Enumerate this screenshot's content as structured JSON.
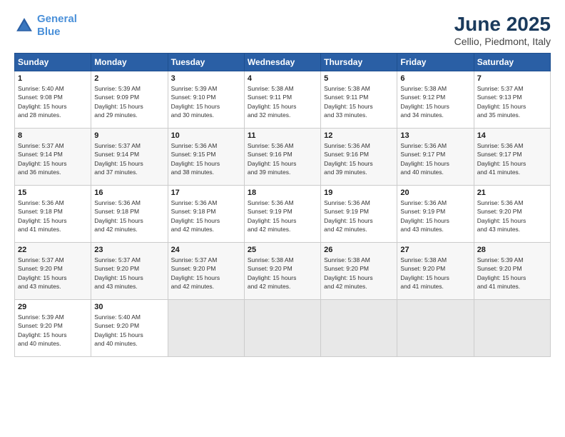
{
  "logo": {
    "line1": "General",
    "line2": "Blue"
  },
  "title": "June 2025",
  "subtitle": "Cellio, Piedmont, Italy",
  "weekdays": [
    "Sunday",
    "Monday",
    "Tuesday",
    "Wednesday",
    "Thursday",
    "Friday",
    "Saturday"
  ],
  "weeks": [
    [
      {
        "day": "1",
        "info": "Sunrise: 5:40 AM\nSunset: 9:08 PM\nDaylight: 15 hours\nand 28 minutes."
      },
      {
        "day": "2",
        "info": "Sunrise: 5:39 AM\nSunset: 9:09 PM\nDaylight: 15 hours\nand 29 minutes."
      },
      {
        "day": "3",
        "info": "Sunrise: 5:39 AM\nSunset: 9:10 PM\nDaylight: 15 hours\nand 30 minutes."
      },
      {
        "day": "4",
        "info": "Sunrise: 5:38 AM\nSunset: 9:11 PM\nDaylight: 15 hours\nand 32 minutes."
      },
      {
        "day": "5",
        "info": "Sunrise: 5:38 AM\nSunset: 9:11 PM\nDaylight: 15 hours\nand 33 minutes."
      },
      {
        "day": "6",
        "info": "Sunrise: 5:38 AM\nSunset: 9:12 PM\nDaylight: 15 hours\nand 34 minutes."
      },
      {
        "day": "7",
        "info": "Sunrise: 5:37 AM\nSunset: 9:13 PM\nDaylight: 15 hours\nand 35 minutes."
      }
    ],
    [
      {
        "day": "8",
        "info": "Sunrise: 5:37 AM\nSunset: 9:14 PM\nDaylight: 15 hours\nand 36 minutes."
      },
      {
        "day": "9",
        "info": "Sunrise: 5:37 AM\nSunset: 9:14 PM\nDaylight: 15 hours\nand 37 minutes."
      },
      {
        "day": "10",
        "info": "Sunrise: 5:36 AM\nSunset: 9:15 PM\nDaylight: 15 hours\nand 38 minutes."
      },
      {
        "day": "11",
        "info": "Sunrise: 5:36 AM\nSunset: 9:16 PM\nDaylight: 15 hours\nand 39 minutes."
      },
      {
        "day": "12",
        "info": "Sunrise: 5:36 AM\nSunset: 9:16 PM\nDaylight: 15 hours\nand 39 minutes."
      },
      {
        "day": "13",
        "info": "Sunrise: 5:36 AM\nSunset: 9:17 PM\nDaylight: 15 hours\nand 40 minutes."
      },
      {
        "day": "14",
        "info": "Sunrise: 5:36 AM\nSunset: 9:17 PM\nDaylight: 15 hours\nand 41 minutes."
      }
    ],
    [
      {
        "day": "15",
        "info": "Sunrise: 5:36 AM\nSunset: 9:18 PM\nDaylight: 15 hours\nand 41 minutes."
      },
      {
        "day": "16",
        "info": "Sunrise: 5:36 AM\nSunset: 9:18 PM\nDaylight: 15 hours\nand 42 minutes."
      },
      {
        "day": "17",
        "info": "Sunrise: 5:36 AM\nSunset: 9:18 PM\nDaylight: 15 hours\nand 42 minutes."
      },
      {
        "day": "18",
        "info": "Sunrise: 5:36 AM\nSunset: 9:19 PM\nDaylight: 15 hours\nand 42 minutes."
      },
      {
        "day": "19",
        "info": "Sunrise: 5:36 AM\nSunset: 9:19 PM\nDaylight: 15 hours\nand 42 minutes."
      },
      {
        "day": "20",
        "info": "Sunrise: 5:36 AM\nSunset: 9:19 PM\nDaylight: 15 hours\nand 43 minutes."
      },
      {
        "day": "21",
        "info": "Sunrise: 5:36 AM\nSunset: 9:20 PM\nDaylight: 15 hours\nand 43 minutes."
      }
    ],
    [
      {
        "day": "22",
        "info": "Sunrise: 5:37 AM\nSunset: 9:20 PM\nDaylight: 15 hours\nand 43 minutes."
      },
      {
        "day": "23",
        "info": "Sunrise: 5:37 AM\nSunset: 9:20 PM\nDaylight: 15 hours\nand 43 minutes."
      },
      {
        "day": "24",
        "info": "Sunrise: 5:37 AM\nSunset: 9:20 PM\nDaylight: 15 hours\nand 42 minutes."
      },
      {
        "day": "25",
        "info": "Sunrise: 5:38 AM\nSunset: 9:20 PM\nDaylight: 15 hours\nand 42 minutes."
      },
      {
        "day": "26",
        "info": "Sunrise: 5:38 AM\nSunset: 9:20 PM\nDaylight: 15 hours\nand 42 minutes."
      },
      {
        "day": "27",
        "info": "Sunrise: 5:38 AM\nSunset: 9:20 PM\nDaylight: 15 hours\nand 41 minutes."
      },
      {
        "day": "28",
        "info": "Sunrise: 5:39 AM\nSunset: 9:20 PM\nDaylight: 15 hours\nand 41 minutes."
      }
    ],
    [
      {
        "day": "29",
        "info": "Sunrise: 5:39 AM\nSunset: 9:20 PM\nDaylight: 15 hours\nand 40 minutes."
      },
      {
        "day": "30",
        "info": "Sunrise: 5:40 AM\nSunset: 9:20 PM\nDaylight: 15 hours\nand 40 minutes."
      },
      {
        "day": "",
        "info": ""
      },
      {
        "day": "",
        "info": ""
      },
      {
        "day": "",
        "info": ""
      },
      {
        "day": "",
        "info": ""
      },
      {
        "day": "",
        "info": ""
      }
    ]
  ]
}
